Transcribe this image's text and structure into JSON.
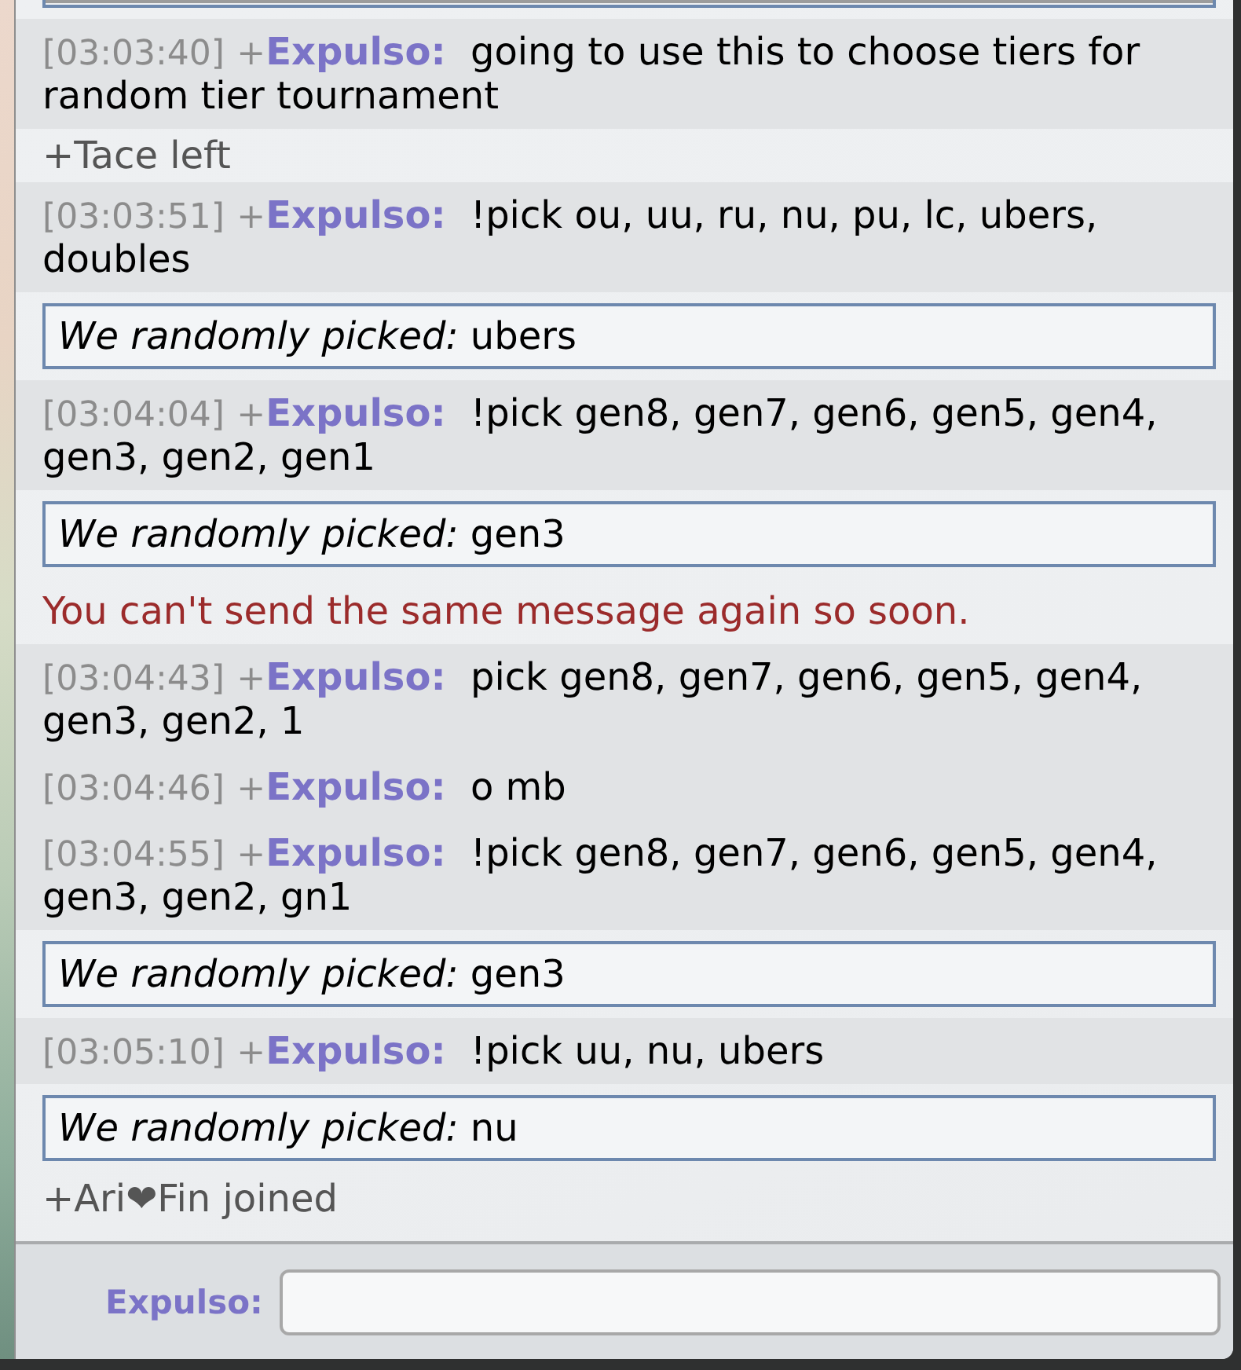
{
  "chat_log": {
    "entries": [
      {
        "kind": "box",
        "clipped": true
      },
      {
        "kind": "chat",
        "time": "[03:03:40]",
        "rank": "+",
        "user": "Expulso:",
        "text": "going to use this to choose tiers for random tier tournament"
      },
      {
        "kind": "notice",
        "text": "+Tace left"
      },
      {
        "kind": "chat",
        "time": "[03:03:51]",
        "rank": "+",
        "user": "Expulso:",
        "text": "!pick ou, uu, ru, nu, pu, lc, ubers, doubles"
      },
      {
        "kind": "box",
        "clipped": false,
        "text": "*We randomly picked:* ubers"
      },
      {
        "kind": "chat",
        "time": "[03:04:04]",
        "rank": "+",
        "user": "Expulso:",
        "text": "!pick gen8, gen7, gen6, gen5, gen4, gen3, gen2, gen1"
      },
      {
        "kind": "box",
        "clipped": false,
        "text": "*We randomly picked:* gen3"
      },
      {
        "kind": "error",
        "text": "You can't send the same message again so soon."
      },
      {
        "kind": "chat",
        "time": "[03:04:43]",
        "rank": "+",
        "user": "Expulso:",
        "text": "pick gen8, gen7, gen6, gen5, gen4, gen3, gen2, 1"
      },
      {
        "kind": "chat",
        "time": "[03:04:46]",
        "rank": "+",
        "user": "Expulso:",
        "text": "o mb"
      },
      {
        "kind": "chat",
        "time": "[03:04:55]",
        "rank": "+",
        "user": "Expulso:",
        "text": "!pick gen8, gen7, gen6, gen5, gen4, gen3, gen2, gn1"
      },
      {
        "kind": "box",
        "clipped": false,
        "text": "*We randomly picked:* gen3"
      },
      {
        "kind": "chat",
        "time": "[03:05:10]",
        "rank": "+",
        "user": "Expulso:",
        "text": "!pick uu, nu, ubers"
      },
      {
        "kind": "box",
        "clipped": false,
        "text": "*We randomly picked:* nu"
      },
      {
        "kind": "notice",
        "text": "+Ari❤Fin joined"
      }
    ]
  },
  "composer": {
    "user": "Expulso:"
  }
}
